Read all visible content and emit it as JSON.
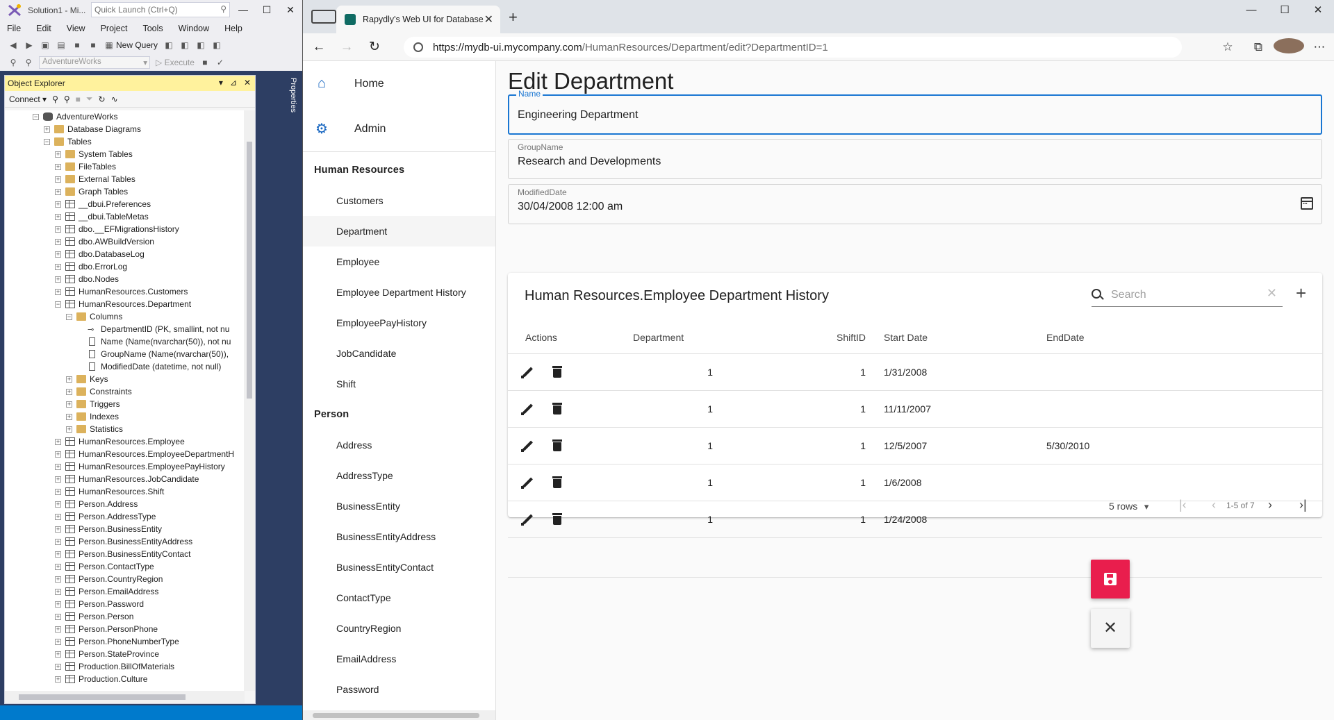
{
  "ssms": {
    "title": "Solution1 - Mi...",
    "quick_launch_placeholder": "Quick Launch (Ctrl+Q)",
    "window_controls": [
      "—",
      "☐",
      "✕"
    ],
    "menu": [
      "File",
      "Edit",
      "View",
      "Project",
      "Tools",
      "Window",
      "Help"
    ],
    "toolbar": {
      "new_query": "New Query",
      "database": "AdventureWorks",
      "execute": "Execute"
    },
    "object_explorer": {
      "title": "Object Explorer",
      "connect_label": "Connect ▾",
      "tree": [
        {
          "label": "AdventureWorks",
          "icon": "database",
          "exp": "−"
        },
        {
          "label": "Database Diagrams",
          "icon": "folder",
          "exp": "+"
        },
        {
          "label": "Tables",
          "icon": "folder",
          "exp": "−"
        },
        {
          "label": "System Tables",
          "icon": "folder",
          "exp": "+"
        },
        {
          "label": "FileTables",
          "icon": "folder",
          "exp": "+"
        },
        {
          "label": "External Tables",
          "icon": "folder",
          "exp": "+"
        },
        {
          "label": "Graph Tables",
          "icon": "folder",
          "exp": "+"
        },
        {
          "label": "__dbui.Preferences",
          "icon": "table",
          "exp": "+"
        },
        {
          "label": "__dbui.TableMetas",
          "icon": "table",
          "exp": "+"
        },
        {
          "label": "dbo.__EFMigrationsHistory",
          "icon": "table",
          "exp": "+"
        },
        {
          "label": "dbo.AWBuildVersion",
          "icon": "table",
          "exp": "+"
        },
        {
          "label": "dbo.DatabaseLog",
          "icon": "table",
          "exp": "+"
        },
        {
          "label": "dbo.ErrorLog",
          "icon": "table",
          "exp": "+"
        },
        {
          "label": "dbo.Nodes",
          "icon": "table",
          "exp": "+"
        },
        {
          "label": "HumanResources.Customers",
          "icon": "table",
          "exp": "+"
        },
        {
          "label": "HumanResources.Department",
          "icon": "table",
          "exp": "−"
        },
        {
          "label": "Columns",
          "icon": "folder",
          "exp": "−"
        },
        {
          "label": "DepartmentID (PK, smallint, not nu",
          "icon": "key",
          "exp": ""
        },
        {
          "label": "Name (Name(nvarchar(50)), not nu",
          "icon": "column",
          "exp": ""
        },
        {
          "label": "GroupName (Name(nvarchar(50)),",
          "icon": "column",
          "exp": ""
        },
        {
          "label": "ModifiedDate (datetime, not null)",
          "icon": "column",
          "exp": ""
        },
        {
          "label": "Keys",
          "icon": "folder",
          "exp": "+"
        },
        {
          "label": "Constraints",
          "icon": "folder",
          "exp": "+"
        },
        {
          "label": "Triggers",
          "icon": "folder",
          "exp": "+"
        },
        {
          "label": "Indexes",
          "icon": "folder",
          "exp": "+"
        },
        {
          "label": "Statistics",
          "icon": "folder",
          "exp": "+"
        },
        {
          "label": "HumanResources.Employee",
          "icon": "table",
          "exp": "+"
        },
        {
          "label": "HumanResources.EmployeeDepartmentH",
          "icon": "table",
          "exp": "+"
        },
        {
          "label": "HumanResources.EmployeePayHistory",
          "icon": "table",
          "exp": "+"
        },
        {
          "label": "HumanResources.JobCandidate",
          "icon": "table",
          "exp": "+"
        },
        {
          "label": "HumanResources.Shift",
          "icon": "table",
          "exp": "+"
        },
        {
          "label": "Person.Address",
          "icon": "table",
          "exp": "+"
        },
        {
          "label": "Person.AddressType",
          "icon": "table",
          "exp": "+"
        },
        {
          "label": "Person.BusinessEntity",
          "icon": "table",
          "exp": "+"
        },
        {
          "label": "Person.BusinessEntityAddress",
          "icon": "table",
          "exp": "+"
        },
        {
          "label": "Person.BusinessEntityContact",
          "icon": "table",
          "exp": "+"
        },
        {
          "label": "Person.ContactType",
          "icon": "table",
          "exp": "+"
        },
        {
          "label": "Person.CountryRegion",
          "icon": "table",
          "exp": "+"
        },
        {
          "label": "Person.EmailAddress",
          "icon": "table",
          "exp": "+"
        },
        {
          "label": "Person.Password",
          "icon": "table",
          "exp": "+"
        },
        {
          "label": "Person.Person",
          "icon": "table",
          "exp": "+"
        },
        {
          "label": "Person.PersonPhone",
          "icon": "table",
          "exp": "+"
        },
        {
          "label": "Person.PhoneNumberType",
          "icon": "table",
          "exp": "+"
        },
        {
          "label": "Person.StateProvince",
          "icon": "table",
          "exp": "+"
        },
        {
          "label": "Production.BillOfMaterials",
          "icon": "table",
          "exp": "+"
        },
        {
          "label": "Production.Culture",
          "icon": "table",
          "exp": "+"
        }
      ]
    },
    "properties_tab": "Properties"
  },
  "browser": {
    "tab_title": "Rapydly's Web UI for Database",
    "url_host": "https://mydb-ui.mycompany.com",
    "url_path": "/HumanResources/Department/edit?DepartmentID=1",
    "window_controls": [
      "—",
      "☐",
      "✕"
    ]
  },
  "sidebar": {
    "top_links": [
      {
        "label": "Home",
        "icon": "home-icon"
      },
      {
        "label": "Admin",
        "icon": "gear-icon"
      }
    ],
    "sections": [
      {
        "title": "Human Resources",
        "items": [
          "Customers",
          "Department",
          "Employee",
          "Employee Department History",
          "EmployeePayHistory",
          "JobCandidate",
          "Shift"
        ]
      },
      {
        "title": "Person",
        "items": [
          "Address",
          "AddressType",
          "BusinessEntity",
          "BusinessEntityAddress",
          "BusinessEntityContact",
          "ContactType",
          "CountryRegion",
          "EmailAddress",
          "Password"
        ]
      }
    ],
    "active_item": "Department"
  },
  "form": {
    "page_title": "Edit Department",
    "name_label": "Name",
    "name_value": "Engineering Department",
    "group_label": "GroupName",
    "group_value": "Research and Developments",
    "date_label": "ModifiedDate",
    "date_value": "30/04/2008 12:00 am"
  },
  "grid": {
    "title": "Human Resources.Employee Department History",
    "search_placeholder": "Search",
    "columns": [
      "Actions",
      "Department",
      "ShiftID",
      "Start Date",
      "EndDate"
    ],
    "rows": [
      {
        "department": "1",
        "shift_id": "1",
        "start_date": "1/31/2008",
        "end_date": ""
      },
      {
        "department": "1",
        "shift_id": "1",
        "start_date": "11/11/2007",
        "end_date": ""
      },
      {
        "department": "1",
        "shift_id": "1",
        "start_date": "12/5/2007",
        "end_date": "5/30/2010"
      },
      {
        "department": "1",
        "shift_id": "1",
        "start_date": "1/6/2008",
        "end_date": ""
      },
      {
        "department": "1",
        "shift_id": "1",
        "start_date": "1/24/2008",
        "end_date": ""
      }
    ],
    "rows_per_page": "5 rows",
    "page_info": "1-5 of 7"
  },
  "colors": {
    "accent": "#1976d2",
    "save_button": "#e91e4d",
    "ssms_status": "#007acc",
    "oe_header": "#fff29d"
  }
}
